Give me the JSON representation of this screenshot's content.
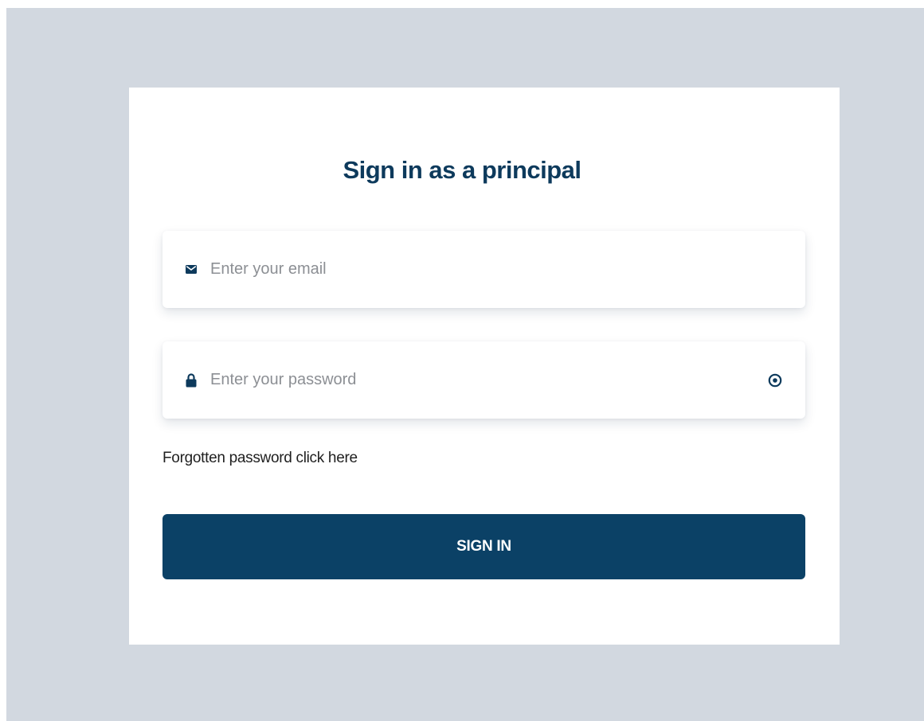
{
  "page": {
    "title": "Sign in as a principal"
  },
  "email": {
    "placeholder": "Enter your email",
    "value": "",
    "icon": "envelope-icon"
  },
  "password": {
    "placeholder": "Enter your password",
    "value": "",
    "icon": "lock-icon",
    "toggle_icon": "eye-icon"
  },
  "forgot": {
    "text": "Forgotten password",
    "link": "click here"
  },
  "signin": {
    "label": "SIGN IN"
  },
  "colors": {
    "backdrop": "#d2d8e0",
    "card": "#ffffff",
    "primary": "#0b4166",
    "title": "#0d3a5c"
  }
}
